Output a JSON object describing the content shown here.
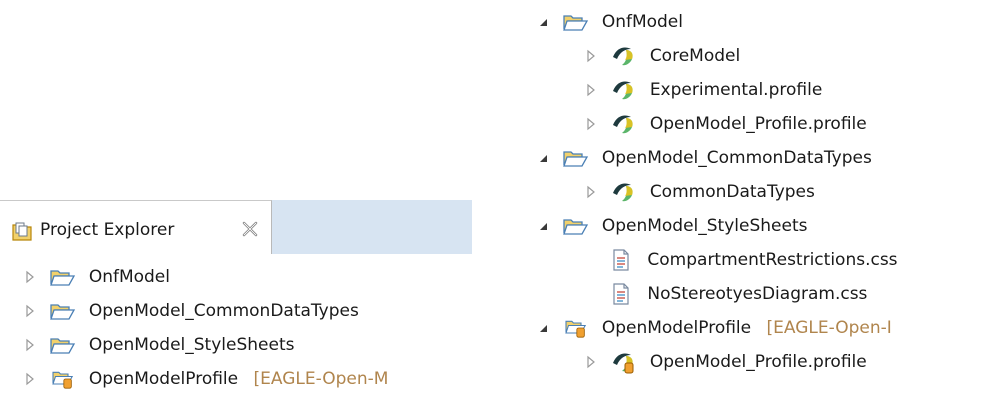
{
  "left_panel": {
    "tab_title": "Project Explorer",
    "items": [
      {
        "label": "OnfModel",
        "icon": "folder-icon"
      },
      {
        "label": "OpenModel_CommonDataTypes",
        "icon": "folder-icon"
      },
      {
        "label": "OpenModel_StyleSheets",
        "icon": "folder-icon"
      },
      {
        "label": "OpenModelProfile",
        "icon": "profile-folder-icon",
        "decoration": "[EAGLE-Open-M"
      }
    ]
  },
  "right_panel": {
    "tree": [
      {
        "label": "OnfModel",
        "expanded": true,
        "children": [
          "CoreModel",
          "Experimental.profile",
          "OpenModel_Profile.profile"
        ]
      },
      {
        "label": "OpenModel_CommonDataTypes",
        "expanded": true,
        "children": [
          "CommonDataTypes"
        ]
      },
      {
        "label": "OpenModel_StyleSheets",
        "expanded": true,
        "children": [
          "CompartmentRestrictions.css",
          "NoStereotyesDiagram.css"
        ]
      },
      {
        "label": "OpenModelProfile",
        "decoration": "[EAGLE-Open-I",
        "expanded": true,
        "children": [
          "OpenModel_Profile.profile"
        ]
      }
    ]
  },
  "colors": {
    "tab_strip": "#d7e4f2",
    "folder": "#f2d16b",
    "folder_stroke": "#4a7fb5",
    "papyrus_dark": "#1e3a3e",
    "papyrus_green": "#5bb56a",
    "papyrus_yellow": "#f0c419",
    "decoration": "#b0854d"
  }
}
